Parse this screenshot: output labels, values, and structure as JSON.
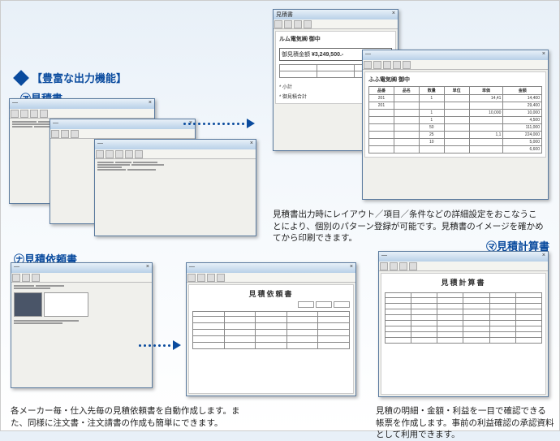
{
  "header": {
    "title": "【豊富な出力機能】"
  },
  "sections": {
    "quote": "㋐見積書",
    "quote_request": "㋤見積依頼書",
    "quote_calc": "㋮見積計算書"
  },
  "captions": {
    "quote_desc": "見積書出力時にレイアウト／項目／条件などの詳細設定をおこなうことにより、個別のパターン登録が可能です。見積書のイメージを確かめてから印刷できます。",
    "request_desc": "各メーカー毎・仕入先毎の見積依頼書を自動作成します。また、同様に注文書・注文請書の作成も簡単にできます。",
    "calc_desc": "見積の明細・金額・利益を一目で確認できる帳票を作成します。事前の利益確認の承認資料として利用できます。"
  },
  "mock_windows": {
    "title_generic": "見積書",
    "close": "×",
    "doc1": {
      "customer": "ルム電気㈱ 御中",
      "amount_label": "御見積金額",
      "amount": "¥3,249,500.-",
      "subtotal_label": "小計",
      "total_label": "御見積合計"
    },
    "doc2": {
      "customer": "ふふ電気㈱ 御中",
      "headers": [
        "品番",
        "品名",
        "数量",
        "単位",
        "単価",
        "金額"
      ],
      "rows": [
        {
          "a": "201",
          "b": "",
          "c": "1",
          "d": "",
          "e": "14,41",
          "f": "14,400"
        },
        {
          "a": "201",
          "b": "",
          "c": "",
          "d": "",
          "e": "",
          "f": "29,400"
        },
        {
          "a": "",
          "b": "",
          "c": "1",
          "d": "",
          "e": "10,000",
          "f": "10,000"
        },
        {
          "a": "",
          "b": "",
          "c": "1",
          "d": "",
          "e": "",
          "f": "4,500"
        },
        {
          "a": "",
          "b": "",
          "c": "50",
          "d": "",
          "e": "",
          "f": "111,000"
        },
        {
          "a": "",
          "b": "",
          "c": "25",
          "d": "",
          "e": "1,1",
          "f": "224,000"
        },
        {
          "a": "",
          "b": "",
          "c": "10",
          "d": "",
          "e": "",
          "f": "5,000"
        },
        {
          "a": "",
          "b": "",
          "c": "",
          "d": "",
          "e": "",
          "f": "6,600"
        }
      ]
    },
    "request_doc": {
      "title": "見積依頼書"
    },
    "calc_doc": {
      "title": "見積計算書"
    }
  }
}
